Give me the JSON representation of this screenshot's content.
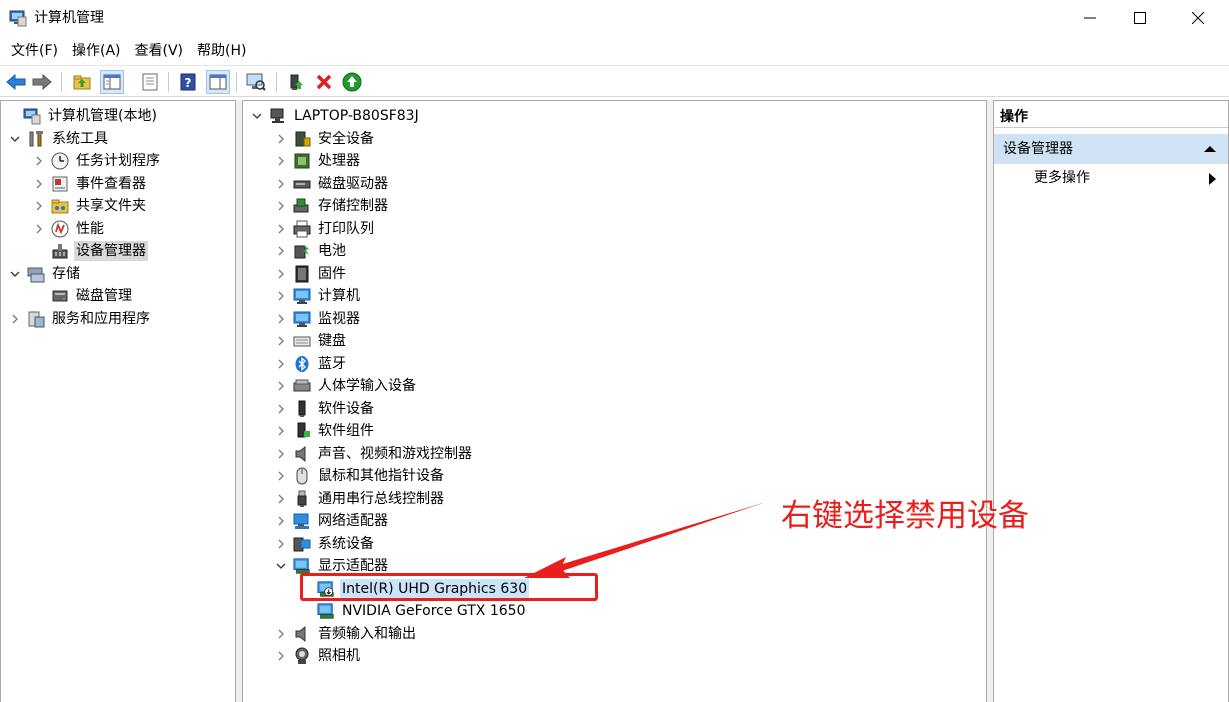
{
  "window": {
    "title": "计算机管理"
  },
  "menu": [
    "文件(F)",
    "操作(A)",
    "查看(V)",
    "帮助(H)"
  ],
  "left_tree": [
    {
      "label": "计算机管理(本地)",
      "icon": "computer-management-icon",
      "level": 0,
      "expand": "none"
    },
    {
      "label": "系统工具",
      "icon": "tools-icon",
      "level": 1,
      "expand": "expanded"
    },
    {
      "label": "任务计划程序",
      "icon": "clock-icon",
      "level": 2,
      "expand": "collapsed"
    },
    {
      "label": "事件查看器",
      "icon": "event-viewer-icon",
      "level": 2,
      "expand": "collapsed"
    },
    {
      "label": "共享文件夹",
      "icon": "shared-folder-icon",
      "level": 2,
      "expand": "collapsed"
    },
    {
      "label": "性能",
      "icon": "performance-icon",
      "level": 2,
      "expand": "collapsed"
    },
    {
      "label": "设备管理器",
      "icon": "device-manager-icon",
      "level": 2,
      "expand": "none",
      "selected": true
    },
    {
      "label": "存储",
      "icon": "storage-icon",
      "level": 1,
      "expand": "expanded"
    },
    {
      "label": "磁盘管理",
      "icon": "disk-management-icon",
      "level": 2,
      "expand": "none"
    },
    {
      "label": "服务和应用程序",
      "icon": "services-icon",
      "level": 1,
      "expand": "collapsed"
    }
  ],
  "device_tree": {
    "root": "LAPTOP-B80SF83J",
    "categories": [
      {
        "label": "安全设备",
        "icon": "security-device-icon"
      },
      {
        "label": "处理器",
        "icon": "processor-icon"
      },
      {
        "label": "磁盘驱动器",
        "icon": "disk-drive-icon"
      },
      {
        "label": "存储控制器",
        "icon": "storage-controller-icon"
      },
      {
        "label": "打印队列",
        "icon": "printer-icon"
      },
      {
        "label": "电池",
        "icon": "battery-icon"
      },
      {
        "label": "固件",
        "icon": "firmware-icon"
      },
      {
        "label": "计算机",
        "icon": "monitor-icon"
      },
      {
        "label": "监视器",
        "icon": "monitor-icon"
      },
      {
        "label": "键盘",
        "icon": "keyboard-icon"
      },
      {
        "label": "蓝牙",
        "icon": "bluetooth-icon"
      },
      {
        "label": "人体学输入设备",
        "icon": "hid-icon"
      },
      {
        "label": "软件设备",
        "icon": "software-device-icon"
      },
      {
        "label": "软件组件",
        "icon": "software-component-icon"
      },
      {
        "label": "声音、视频和游戏控制器",
        "icon": "speaker-icon"
      },
      {
        "label": "鼠标和其他指针设备",
        "icon": "mouse-icon"
      },
      {
        "label": "通用串行总线控制器",
        "icon": "usb-icon"
      },
      {
        "label": "网络适配器",
        "icon": "network-adapter-icon"
      },
      {
        "label": "系统设备",
        "icon": "system-device-icon"
      },
      {
        "label": "显示适配器",
        "icon": "display-adapter-icon",
        "expanded": true,
        "children": [
          {
            "label": "Intel(R) UHD Graphics 630",
            "icon": "display-adapter-disabled-icon",
            "highlight": true
          },
          {
            "label": "NVIDIA GeForce GTX 1650",
            "icon": "display-adapter-icon"
          }
        ]
      },
      {
        "label": "音频输入和输出",
        "icon": "speaker-icon"
      },
      {
        "label": "照相机",
        "icon": "camera-icon"
      }
    ]
  },
  "actions": {
    "title": "操作",
    "section": "设备管理器",
    "more": "更多操作"
  },
  "annotation": {
    "text": "右键选择禁用设备",
    "color": "#e8201d"
  }
}
